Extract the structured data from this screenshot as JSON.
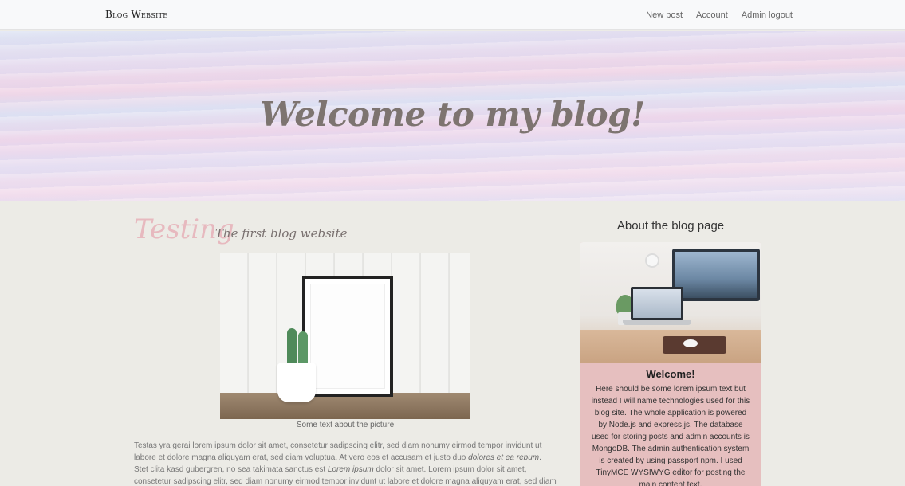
{
  "navbar": {
    "brand": "Blog Website",
    "links": [
      "New post",
      "Account",
      "Admin logout"
    ]
  },
  "hero": {
    "title": "Welcome to my blog!"
  },
  "post": {
    "title": "Testing",
    "subtitle": "The first blog website",
    "image_caption": "Some text about the picture",
    "body_part1": "Testas yra gerai lorem ipsum dolor sit amet, consetetur sadipscing elitr, sed diam nonumy eirmod tempor invidunt ut labore et dolore magna aliquyam erat, sed diam voluptua. At vero eos et accusam et justo duo ",
    "body_em1": "dolores et ea rebum",
    "body_part2": ". Stet clita kasd gubergren, no sea takimata sanctus est ",
    "body_em2": "Lorem ipsum",
    "body_part3": " dolor sit amet. Lorem ipsum dolor sit amet, consetetur sadipscing elitr, sed diam nonumy eirmod tempor invidunt ut labore et dolore magna aliquyam erat, sed diam voluptua."
  },
  "sidebar": {
    "heading": "About the blog page",
    "card_title": "Welcome!",
    "card_text": "Here should be some lorem ipsum text but instead I will name technologies used for this blog site. The whole application is powered by Node.js and express.js. The database used for storing posts and admin accounts is MongoDB. The admin authentication system is created by using passport npm. I used TinyMCE WYSIWYG editor for posting the main content text."
  }
}
